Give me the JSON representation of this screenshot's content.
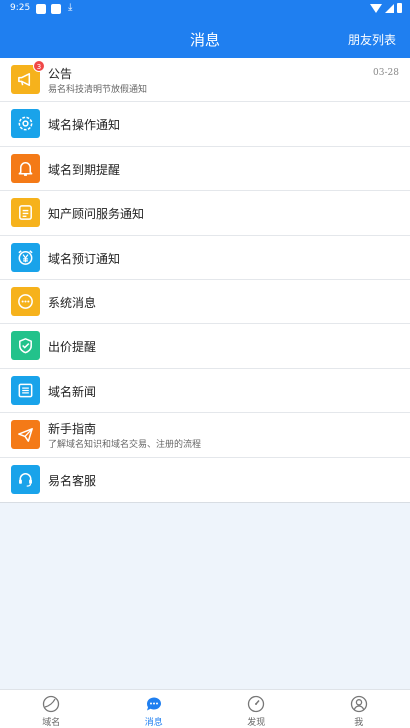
{
  "status_bar": {
    "time": "9:25"
  },
  "header": {
    "title": "消息",
    "friends_link": "朋友列表"
  },
  "messages": [
    {
      "title": "公告",
      "subtitle": "易名科技清明节放假通知",
      "date": "03-28",
      "badge": "3",
      "icon": "megaphone-icon",
      "color": "#f6b21c"
    },
    {
      "title": "域名操作通知",
      "icon": "gear-icon",
      "color": "#19a3ea"
    },
    {
      "title": "域名到期提醒",
      "icon": "bell-icon",
      "color": "#f47a17"
    },
    {
      "title": "知产顾问服务通知",
      "icon": "list-icon",
      "color": "#f6b21c"
    },
    {
      "title": "域名预订通知",
      "icon": "yen-clock-icon",
      "color": "#19a3ea"
    },
    {
      "title": "系统消息",
      "icon": "dots-bubble-icon",
      "color": "#f6b21c"
    },
    {
      "title": "出价提醒",
      "icon": "check-shield-icon",
      "color": "#23c28b"
    },
    {
      "title": "域名新闻",
      "icon": "news-icon",
      "color": "#19a3ea"
    },
    {
      "title": "新手指南",
      "subtitle": "了解域名知识和域名交易、注册的流程",
      "icon": "paper-plane-icon",
      "color": "#f47a17"
    },
    {
      "title": "易名客服",
      "icon": "headset-icon",
      "color": "#19a3ea"
    }
  ],
  "tabs": [
    {
      "label": "域名",
      "icon": "globe-icon",
      "active": false
    },
    {
      "label": "消息",
      "icon": "chat-icon",
      "active": true
    },
    {
      "label": "发现",
      "icon": "compass-icon",
      "active": false
    },
    {
      "label": "我",
      "icon": "user-icon",
      "active": false
    }
  ],
  "colors": {
    "primary": "#1f7ff0",
    "badge": "#f04848"
  }
}
